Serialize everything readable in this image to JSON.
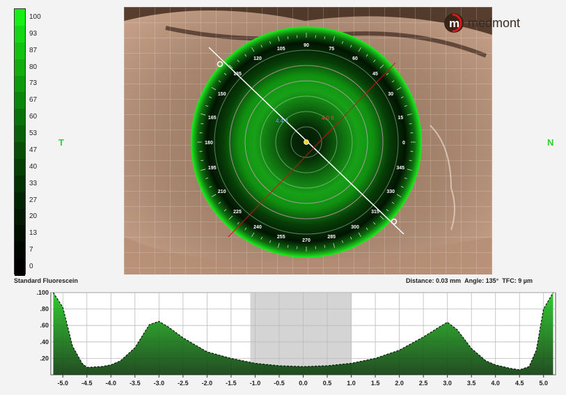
{
  "colorbar": {
    "labels": [
      "100",
      "93",
      "87",
      "80",
      "73",
      "67",
      "60",
      "53",
      "47",
      "40",
      "33",
      "27",
      "20",
      "13",
      "7",
      "0"
    ],
    "colors": [
      "#16ee16",
      "#14d614",
      "#12c112",
      "#10ac10",
      "#0e980e",
      "#0c850c",
      "#0a720a",
      "#086008",
      "#074f07",
      "#053f05",
      "#043104",
      "#032403",
      "#021902",
      "#010f01",
      "#000700",
      "#000000"
    ]
  },
  "left_side_letter": "T",
  "right_side_letter": "N",
  "logo": {
    "mark": "m",
    "text": "medmont"
  },
  "eye_map": {
    "angle_labels": [
      "0",
      "15",
      "30",
      "45",
      "60",
      "75",
      "90",
      "105",
      "120",
      "135",
      "150",
      "165",
      "180",
      "195",
      "210",
      "225",
      "240",
      "255",
      "270",
      "285",
      "300",
      "315",
      "330",
      "345"
    ],
    "left_readout": "4.4 4",
    "right_readout": "4.0 6"
  },
  "status_left": "Standard Fluorescein",
  "status_right": {
    "distance_label": "Distance:",
    "distance_value": "0.03 mm",
    "angle_label": "Angle:",
    "angle_value": "135°",
    "tfc_label": "TFC:",
    "tfc_value": "9 µm"
  },
  "chart_data": {
    "type": "area",
    "xlabel": "",
    "ylabel": "",
    "xlim": [
      -5.25,
      5.25
    ],
    "ylim": [
      0,
      1.0
    ],
    "x_ticks": [
      "-5.0",
      "-4.5",
      "-4.0",
      "-3.5",
      "-3.0",
      "-2.5",
      "-2.0",
      "-1.5",
      "-1.0",
      "-0.5",
      "0.0",
      "0.5",
      "1.0",
      "1.5",
      "2.0",
      "2.5",
      "3.0",
      "3.5",
      "4.0",
      "4.5",
      "5.0"
    ],
    "y_ticks": [
      ".100",
      ".80",
      ".60",
      ".40",
      ".20"
    ],
    "shaded_region": [
      -1.1,
      1.0
    ],
    "series": [
      {
        "x": [
          -5.2,
          -5.0,
          -4.8,
          -4.6,
          -4.5,
          -4.2,
          -4.0,
          -3.8,
          -3.5,
          -3.2,
          -3.0,
          -2.8,
          -2.5,
          -2.0,
          -1.5,
          -1.0,
          -0.5,
          0.0,
          0.5,
          1.0,
          1.5,
          2.0,
          2.5,
          2.8,
          3.0,
          3.2,
          3.5,
          3.8,
          4.0,
          4.3,
          4.5,
          4.7,
          4.85,
          5.0,
          5.2
        ],
        "y": [
          1.0,
          0.82,
          0.35,
          0.14,
          0.09,
          0.1,
          0.12,
          0.17,
          0.33,
          0.61,
          0.65,
          0.58,
          0.45,
          0.28,
          0.2,
          0.14,
          0.11,
          0.1,
          0.11,
          0.14,
          0.2,
          0.3,
          0.46,
          0.57,
          0.64,
          0.55,
          0.32,
          0.17,
          0.12,
          0.08,
          0.06,
          0.1,
          0.3,
          0.8,
          1.0
        ]
      }
    ]
  }
}
